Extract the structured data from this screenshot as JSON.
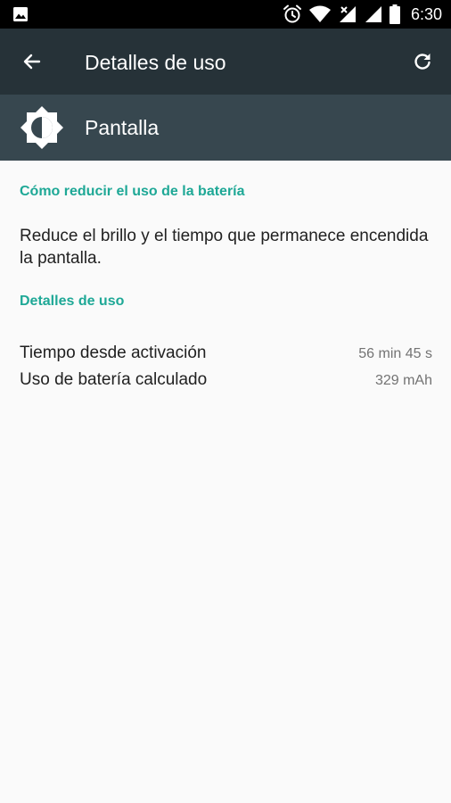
{
  "status_bar": {
    "time": "6:30",
    "icons": [
      "image-icon",
      "alarm-icon",
      "wifi-icon",
      "signal-icon",
      "signal-icon",
      "battery-icon"
    ]
  },
  "toolbar": {
    "title": "Detalles de uso",
    "back_icon": "arrow-back-icon",
    "refresh_icon": "refresh-icon",
    "background": "#263238"
  },
  "app_header": {
    "name": "Pantalla",
    "icon": "brightness-icon",
    "background": "#37474f"
  },
  "tips_section": {
    "header": "Cómo reducir el uso de la batería",
    "text": "Reduce el brillo y el tiempo que permanece encendida la pantalla."
  },
  "details_section": {
    "header": "Detalles de uso",
    "rows": [
      {
        "label": "Tiempo desde activación",
        "value": "56 min 45 s"
      },
      {
        "label": "Uso de batería calculado",
        "value": "329 mAh"
      }
    ]
  },
  "colors": {
    "accent": "#1ea896",
    "background": "#fafafa"
  }
}
